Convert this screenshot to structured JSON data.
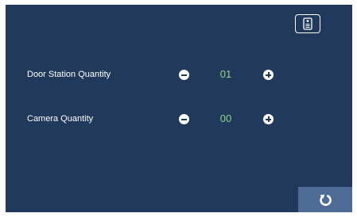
{
  "header": {
    "device_button_icon": "door-station-icon"
  },
  "settings": {
    "rows": [
      {
        "label": "Door Station Quantity",
        "value": "01",
        "decrement_icon": "minus-circle-icon",
        "increment_icon": "plus-circle-icon"
      },
      {
        "label": "Camera Quantity",
        "value": "00",
        "decrement_icon": "minus-circle-icon",
        "increment_icon": "plus-circle-icon"
      }
    ]
  },
  "footer": {
    "back_icon": "return-icon"
  },
  "colors": {
    "background": "#213a5c",
    "value_text": "#8fd48a",
    "back_button": "#4d6b94",
    "label_text": "#ffffff"
  }
}
